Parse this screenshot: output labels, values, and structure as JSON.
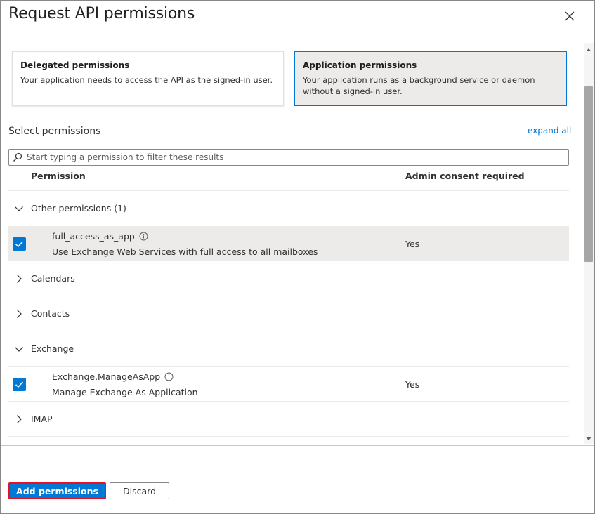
{
  "panel": {
    "title": "Request API permissions"
  },
  "cards": {
    "delegated": {
      "title": "Delegated permissions",
      "description": "Your application needs to access the API as the signed-in user."
    },
    "application": {
      "title": "Application permissions",
      "description": "Your application runs as a background service or daemon without a signed-in user."
    }
  },
  "select": {
    "label": "Select permissions",
    "expand_all": "expand all",
    "search_placeholder": "Start typing a permission to filter these results"
  },
  "table": {
    "col_permission": "Permission",
    "col_admin": "Admin consent required",
    "groups": {
      "other": "Other permissions (1)",
      "calendars": "Calendars",
      "contacts": "Contacts",
      "exchange": "Exchange",
      "imap": "IMAP"
    },
    "rows": {
      "full_access": {
        "name": "full_access_as_app",
        "description": "Use Exchange Web Services with full access to all mailboxes",
        "admin": "Yes",
        "checked": true
      },
      "manage": {
        "name": "Exchange.ManageAsApp",
        "description": "Manage Exchange As Application",
        "admin": "Yes",
        "checked": true
      }
    }
  },
  "footer": {
    "add_label": "Add permissions",
    "discard_label": "Discard"
  },
  "colors": {
    "accent": "#0078d4",
    "highlight_border": "#e81123",
    "selected_row": "#edebe9"
  }
}
